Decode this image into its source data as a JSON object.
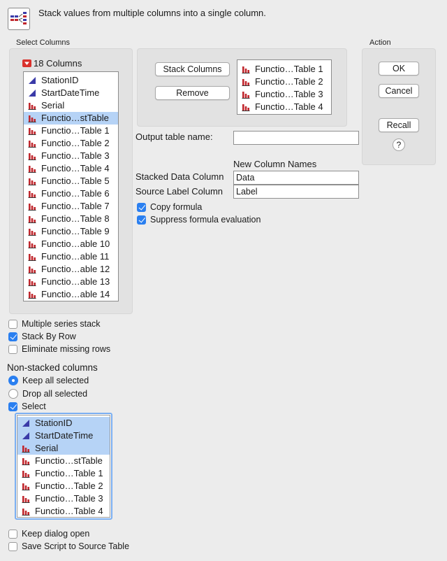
{
  "instruction": "Stack values from multiple columns into a single column.",
  "colors": {
    "selection": "#b6d3f6",
    "accent": "#2a7ff0",
    "continuous_icon": "#3a3aa8",
    "nominal_icon": "#c0272d"
  },
  "select_columns": {
    "group_label": "Select Columns",
    "count_label": "18 Columns",
    "items": [
      {
        "label": "StationID",
        "icon": "continuous-icon",
        "selected": false
      },
      {
        "label": "StartDateTime",
        "icon": "continuous-icon",
        "selected": false
      },
      {
        "label": "Serial",
        "icon": "nominal-bar-icon",
        "selected": false
      },
      {
        "label": "Functio…stTable",
        "icon": "nominal-bar-icon",
        "selected": true
      },
      {
        "label": "Functio…Table 1",
        "icon": "nominal-bar-icon",
        "selected": false
      },
      {
        "label": "Functio…Table 2",
        "icon": "nominal-bar-icon",
        "selected": false
      },
      {
        "label": "Functio…Table 3",
        "icon": "nominal-bar-icon",
        "selected": false
      },
      {
        "label": "Functio…Table 4",
        "icon": "nominal-bar-icon",
        "selected": false
      },
      {
        "label": "Functio…Table 5",
        "icon": "nominal-bar-icon",
        "selected": false
      },
      {
        "label": "Functio…Table 6",
        "icon": "nominal-bar-icon",
        "selected": false
      },
      {
        "label": "Functio…Table 7",
        "icon": "nominal-bar-icon",
        "selected": false
      },
      {
        "label": "Functio…Table 8",
        "icon": "nominal-bar-icon",
        "selected": false
      },
      {
        "label": "Functio…Table 9",
        "icon": "nominal-bar-icon",
        "selected": false
      },
      {
        "label": "Functio…able 10",
        "icon": "nominal-bar-icon",
        "selected": false
      },
      {
        "label": "Functio…able 11",
        "icon": "nominal-bar-icon",
        "selected": false
      },
      {
        "label": "Functio…able 12",
        "icon": "nominal-bar-icon",
        "selected": false
      },
      {
        "label": "Functio…able 13",
        "icon": "nominal-bar-icon",
        "selected": false
      },
      {
        "label": "Functio…able 14",
        "icon": "nominal-bar-icon",
        "selected": false
      }
    ]
  },
  "stack": {
    "stack_button": "Stack Columns",
    "remove_button": "Remove",
    "items": [
      {
        "label": "Functio…Table 1",
        "icon": "nominal-bar-icon"
      },
      {
        "label": "Functio…Table 2",
        "icon": "nominal-bar-icon"
      },
      {
        "label": "Functio…Table 3",
        "icon": "nominal-bar-icon"
      },
      {
        "label": "Functio…Table 4",
        "icon": "nominal-bar-icon"
      }
    ]
  },
  "output": {
    "label": "Output table name:",
    "value": ""
  },
  "new_column_names": {
    "heading": "New Column Names",
    "stacked_label": "Stacked Data Column",
    "stacked_value": "Data",
    "source_label": "Source Label Column",
    "source_value": "Label"
  },
  "formula_options": {
    "copy_formula": {
      "label": "Copy formula",
      "checked": true
    },
    "suppress_eval": {
      "label": "Suppress formula evaluation",
      "checked": true
    }
  },
  "action": {
    "group_label": "Action",
    "ok": "OK",
    "cancel": "Cancel",
    "recall": "Recall",
    "help": "?"
  },
  "stack_options": {
    "multiple_series": {
      "label": "Multiple series stack",
      "checked": false
    },
    "stack_by_row": {
      "label": "Stack By Row",
      "checked": true
    },
    "eliminate_missing": {
      "label": "Eliminate missing rows",
      "checked": false
    }
  },
  "non_stacked": {
    "heading": "Non-stacked columns",
    "keep_all": {
      "label": "Keep all selected",
      "selected": true
    },
    "drop_all": {
      "label": "Drop all selected",
      "selected": false
    },
    "select": {
      "label": "Select",
      "checked": true
    },
    "items": [
      {
        "label": "StationID",
        "icon": "continuous-icon",
        "selected": true
      },
      {
        "label": "StartDateTime",
        "icon": "continuous-icon",
        "selected": true
      },
      {
        "label": "Serial",
        "icon": "nominal-bar-icon",
        "selected": true
      },
      {
        "label": "Functio…stTable",
        "icon": "nominal-bar-icon",
        "selected": false
      },
      {
        "label": "Functio…Table 1",
        "icon": "nominal-bar-icon",
        "selected": false
      },
      {
        "label": "Functio…Table 2",
        "icon": "nominal-bar-icon",
        "selected": false
      },
      {
        "label": "Functio…Table 3",
        "icon": "nominal-bar-icon",
        "selected": false
      },
      {
        "label": "Functio…Table 4",
        "icon": "nominal-bar-icon",
        "selected": false
      }
    ]
  },
  "bottom_options": {
    "keep_dialog_open": {
      "label": "Keep dialog open",
      "checked": false
    },
    "save_script": {
      "label": "Save Script to Source Table",
      "checked": false
    }
  }
}
